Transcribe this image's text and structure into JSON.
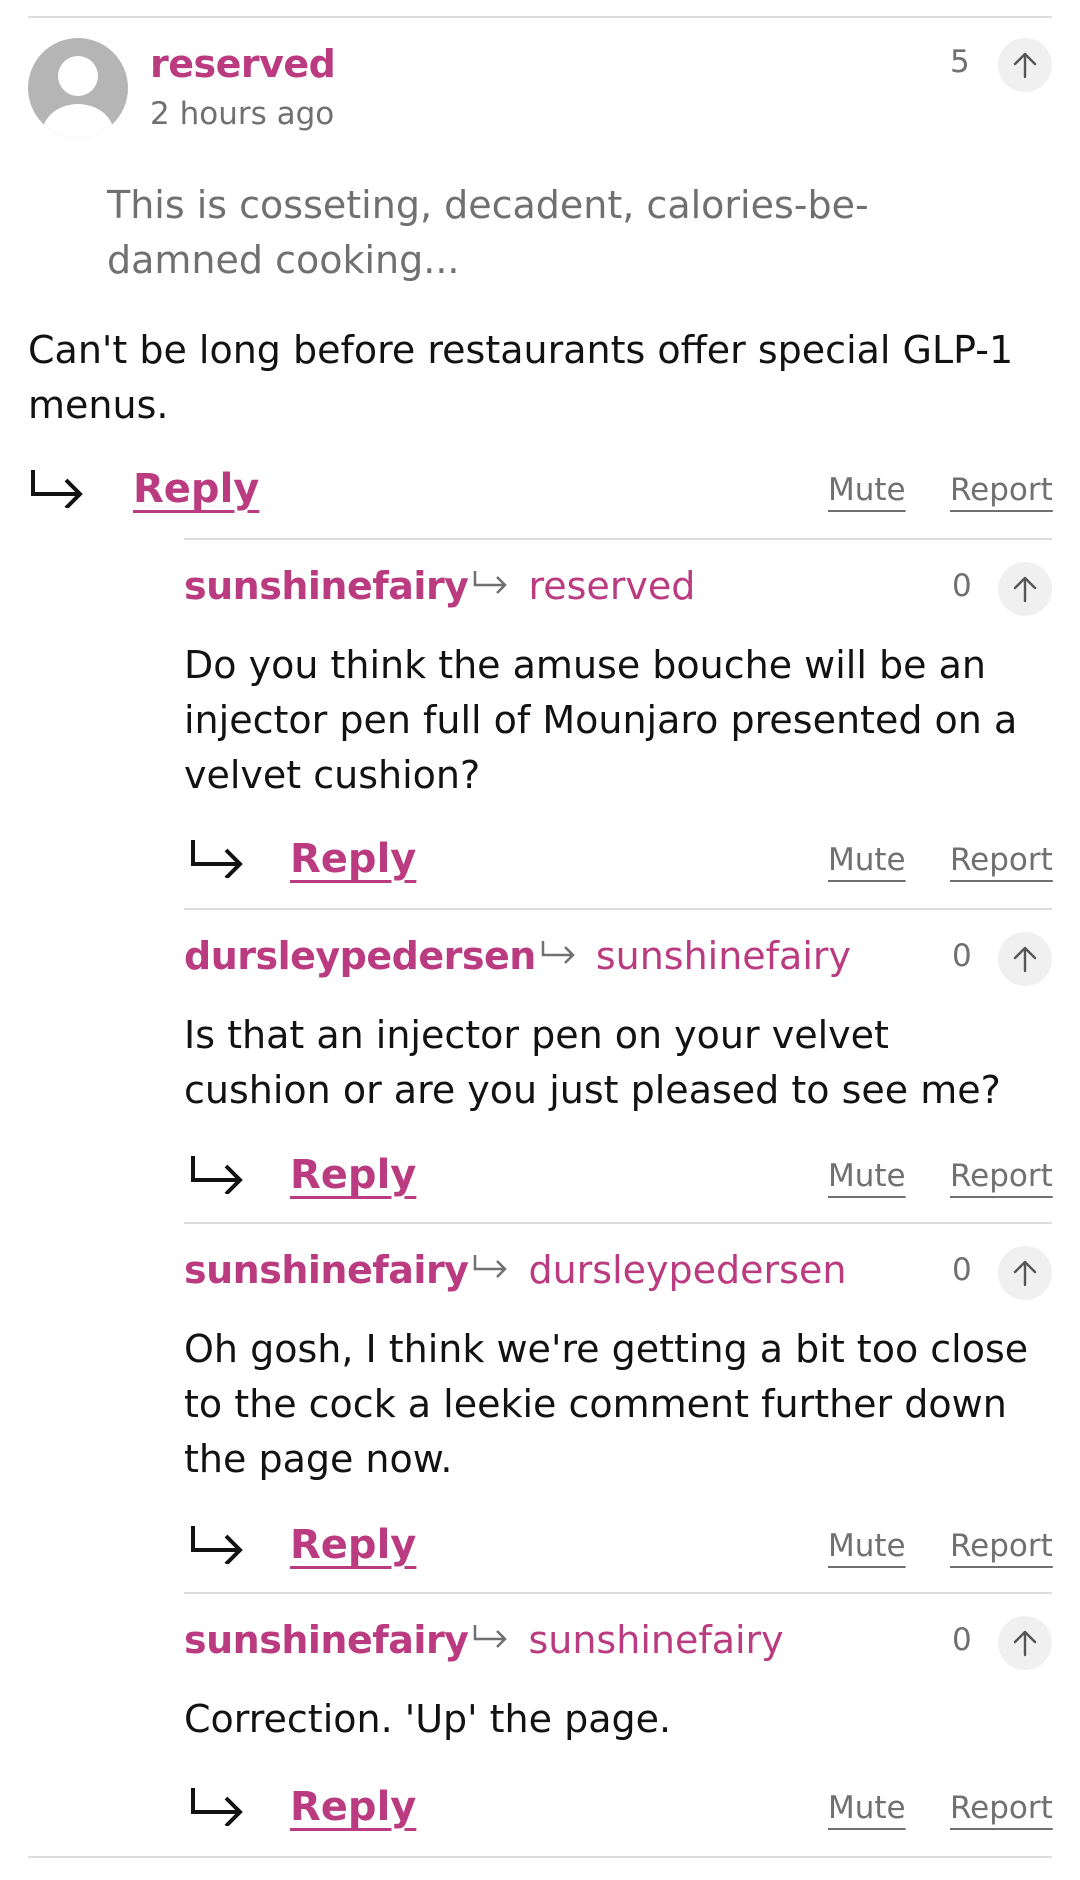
{
  "comment": {
    "author": "reserved",
    "time": "2 hours ago",
    "votes": "5",
    "quote": "This is cosseting, decadent, calories-be-damned cooking...",
    "body": "Can't be long before restaurants offer special GLP-1 menus.",
    "reply_label": "Reply",
    "mute_label": "Mute",
    "report_label": "Report"
  },
  "replies": [
    {
      "author": "sunshinefairy",
      "target": "reserved",
      "votes": "0",
      "body": "Do you think the amuse bouche will be an injector pen full of Mounjaro presented on a velvet cushion?",
      "reply_label": "Reply",
      "mute_label": "Mute",
      "report_label": "Report"
    },
    {
      "author": "dursleypedersen",
      "target": "sunshinefairy",
      "votes": "0",
      "body": "Is that an injector pen on your velvet cushion or are you just pleased to see me?",
      "reply_label": "Reply",
      "mute_label": "Mute",
      "report_label": "Report"
    },
    {
      "author": "sunshinefairy",
      "target": "dursleypedersen",
      "votes": "0",
      "body": "Oh gosh, I think we're getting a bit too close to the cock a leekie comment further down the page now.",
      "reply_label": "Reply",
      "mute_label": "Mute",
      "report_label": "Report"
    },
    {
      "author": "sunshinefairy",
      "target": "sunshinefairy",
      "votes": "0",
      "body": "Correction. 'Up' the page.",
      "reply_label": "Reply",
      "mute_label": "Mute",
      "report_label": "Report"
    }
  ],
  "colors": {
    "accent": "#bb3b80",
    "muted_text": "#707070",
    "divider": "#dcdcdc"
  },
  "icons": {
    "avatar": "default-avatar-icon",
    "upvote": "arrow-up-icon",
    "reply": "reply-arrow-icon",
    "reply_to": "reply-to-icon"
  }
}
